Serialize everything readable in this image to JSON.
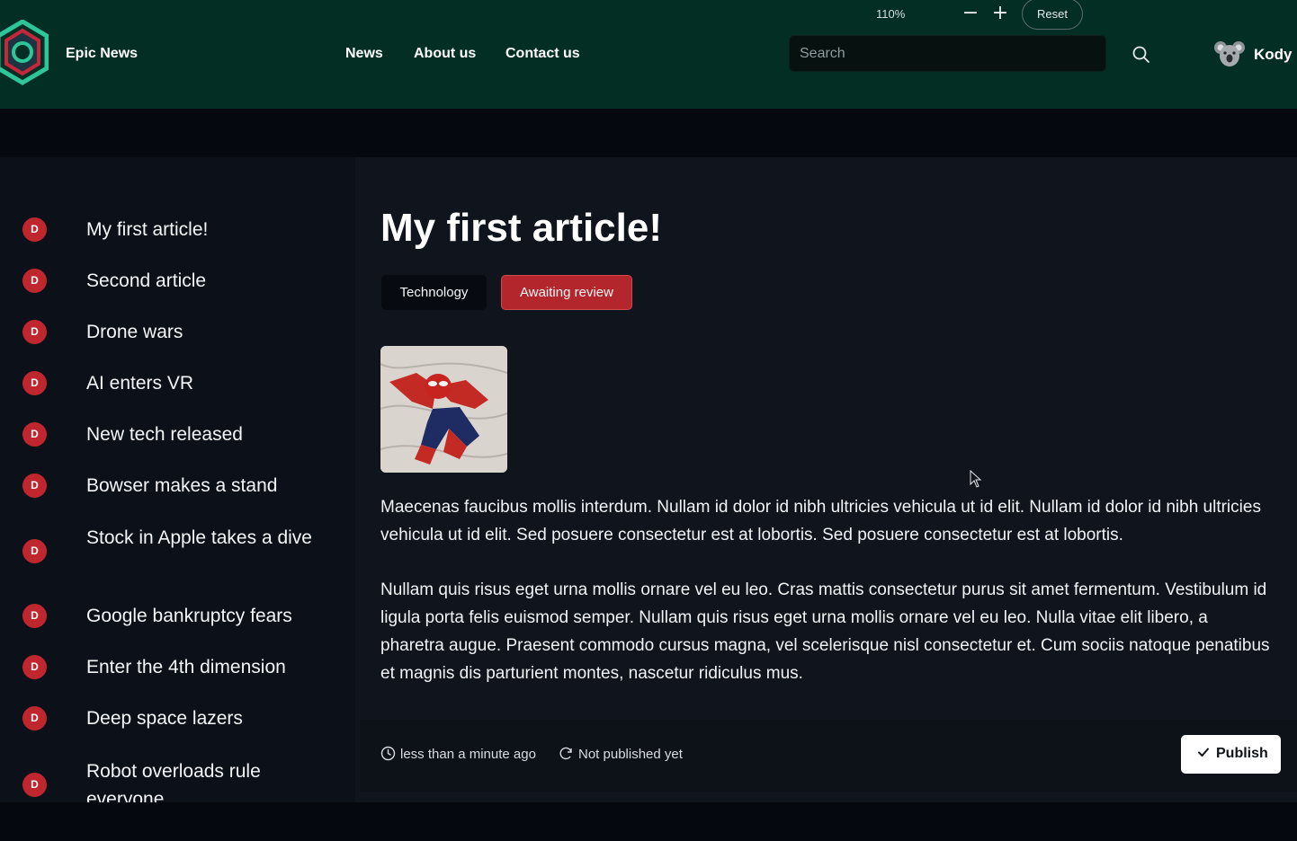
{
  "header": {
    "brand": "Epic News",
    "nav": [
      "News",
      "About us",
      "Contact us"
    ],
    "zoom": {
      "level": "110%",
      "minus": "−",
      "plus": "+",
      "reset": "Reset"
    },
    "search": {
      "placeholder": "Search",
      "value": ""
    },
    "user": {
      "name": "Kody"
    }
  },
  "colors": {
    "header_bg": "#032e23",
    "page_bg": "#05080f",
    "panel_bg": "#0f141d",
    "draft_badge": "#c0262d",
    "status_tag": "#b3262b"
  },
  "sidebar": {
    "items": [
      {
        "badge": "D",
        "label": "My first article!"
      },
      {
        "badge": "D",
        "label": "Second article"
      },
      {
        "badge": "D",
        "label": "Drone wars"
      },
      {
        "badge": "D",
        "label": "AI enters VR"
      },
      {
        "badge": "D",
        "label": "New tech released"
      },
      {
        "badge": "D",
        "label": "Bowser makes a stand"
      },
      {
        "badge": "D",
        "label": "Stock in Apple takes a dive"
      },
      {
        "badge": "D",
        "label": "Google bankruptcy fears"
      },
      {
        "badge": "D",
        "label": "Enter the 4th dimension"
      },
      {
        "badge": "D",
        "label": "Deep space lazers"
      },
      {
        "badge": "D",
        "label": "Robot overloads rule everyone"
      }
    ]
  },
  "article": {
    "title": "My first article!",
    "category": "Technology",
    "status": "Awaiting review",
    "paragraphs": [
      "Maecenas faucibus mollis interdum. Nullam id dolor id nibh ultricies vehicula ut id elit. Nullam id dolor id nibh ultricies vehicula ut id elit. Sed posuere consectetur est at lobortis. Sed posuere consectetur est at lobortis.",
      "Nullam quis risus eget urna mollis ornare vel eu leo. Cras mattis consectetur purus sit amet fermentum. Vestibulum id ligula porta felis euismod semper. Nullam quis risus eget urna mollis ornare vel eu leo. Nulla vitae elit libero, a pharetra augue. Praesent commodo cursus magna, vel scelerisque nisl consectetur et. Cum sociis natoque penatibus et magnis dis parturient montes, nascetur ridiculus mus."
    ],
    "updated": "less than a minute ago",
    "published": "Not published yet",
    "publish_button": "Publish",
    "icons": {
      "updated": "clock-icon",
      "published": "refresh-icon",
      "publish": "check-icon"
    }
  }
}
